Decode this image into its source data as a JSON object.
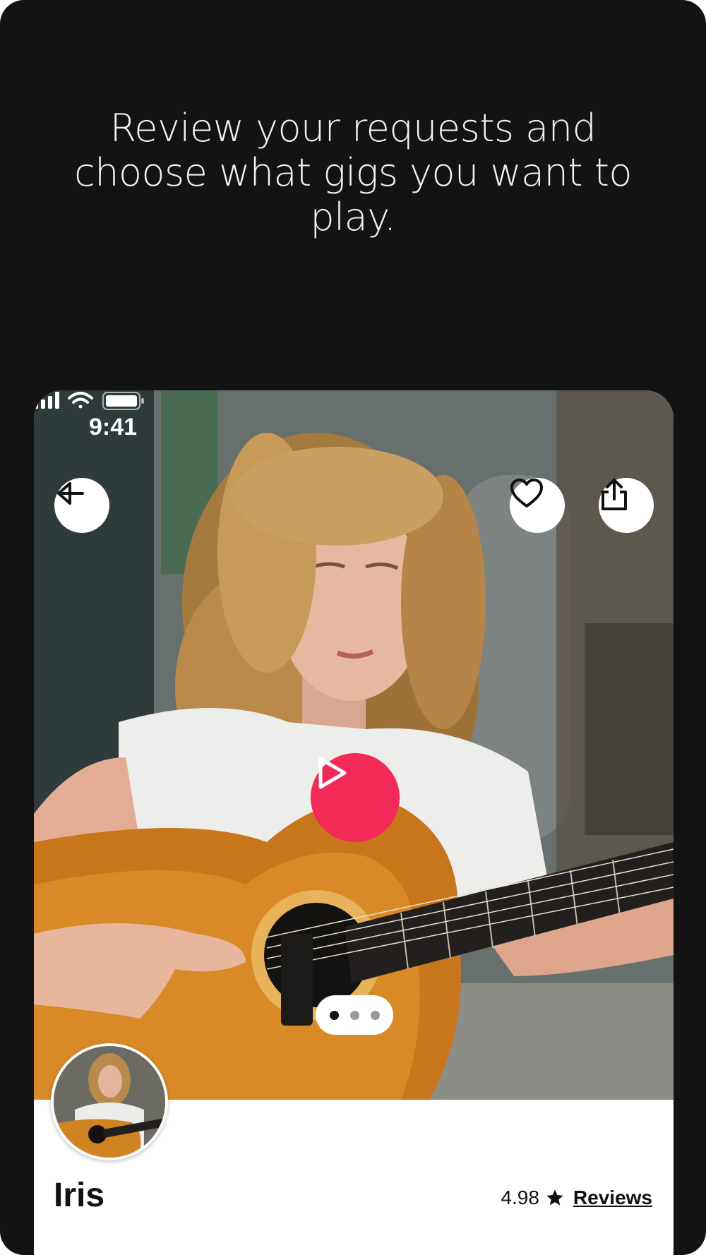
{
  "headline": "Review your requests and choose what gigs you want to play.",
  "status_bar": {
    "time": "9:41",
    "icons": [
      "signal-icon",
      "wifi-icon",
      "battery-icon"
    ]
  },
  "profile": {
    "photo_subject": "woman-playing-acoustic-guitar",
    "name": "Iris",
    "rating": "4.98",
    "reviews_label": "Reviews",
    "gallery_pages": 3,
    "gallery_active_page": 1
  },
  "buttons": {
    "back_icon": "back-arrow-icon",
    "favorite_icon": "heart-icon",
    "share_icon": "share-icon",
    "play_icon": "play-icon"
  },
  "colors": {
    "background": "#131313",
    "accent": "#f22a57",
    "card": "#ffffff"
  }
}
